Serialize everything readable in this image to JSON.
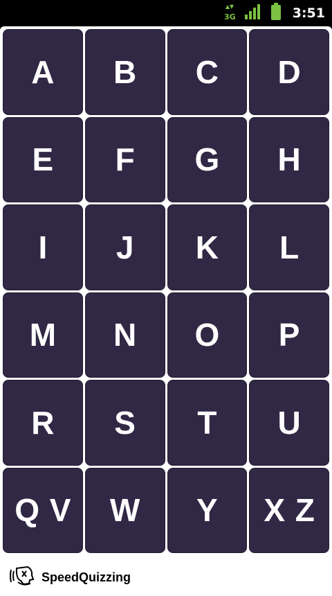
{
  "status_bar": {
    "network_label": "3G",
    "time": "3:51",
    "icons": [
      "data-transfer-icon",
      "signal-strength-icon",
      "battery-icon"
    ],
    "accent_color": "#7cc242"
  },
  "keypad": {
    "tile_color": "#302844",
    "keys": [
      {
        "label": "A"
      },
      {
        "label": "B"
      },
      {
        "label": "C"
      },
      {
        "label": "D"
      },
      {
        "label": "E"
      },
      {
        "label": "F"
      },
      {
        "label": "G"
      },
      {
        "label": "H"
      },
      {
        "label": "I"
      },
      {
        "label": "J"
      },
      {
        "label": "K"
      },
      {
        "label": "L"
      },
      {
        "label": "M"
      },
      {
        "label": "N"
      },
      {
        "label": "O"
      },
      {
        "label": "P"
      },
      {
        "label": "R"
      },
      {
        "label": "S"
      },
      {
        "label": "T"
      },
      {
        "label": "U"
      },
      {
        "label": "Q V"
      },
      {
        "label": "W"
      },
      {
        "label": "Y"
      },
      {
        "label": "X Z"
      }
    ]
  },
  "footer": {
    "brand_name": "SpeedQuizzing",
    "logo_icon": "speedquizzing-logo-icon"
  }
}
